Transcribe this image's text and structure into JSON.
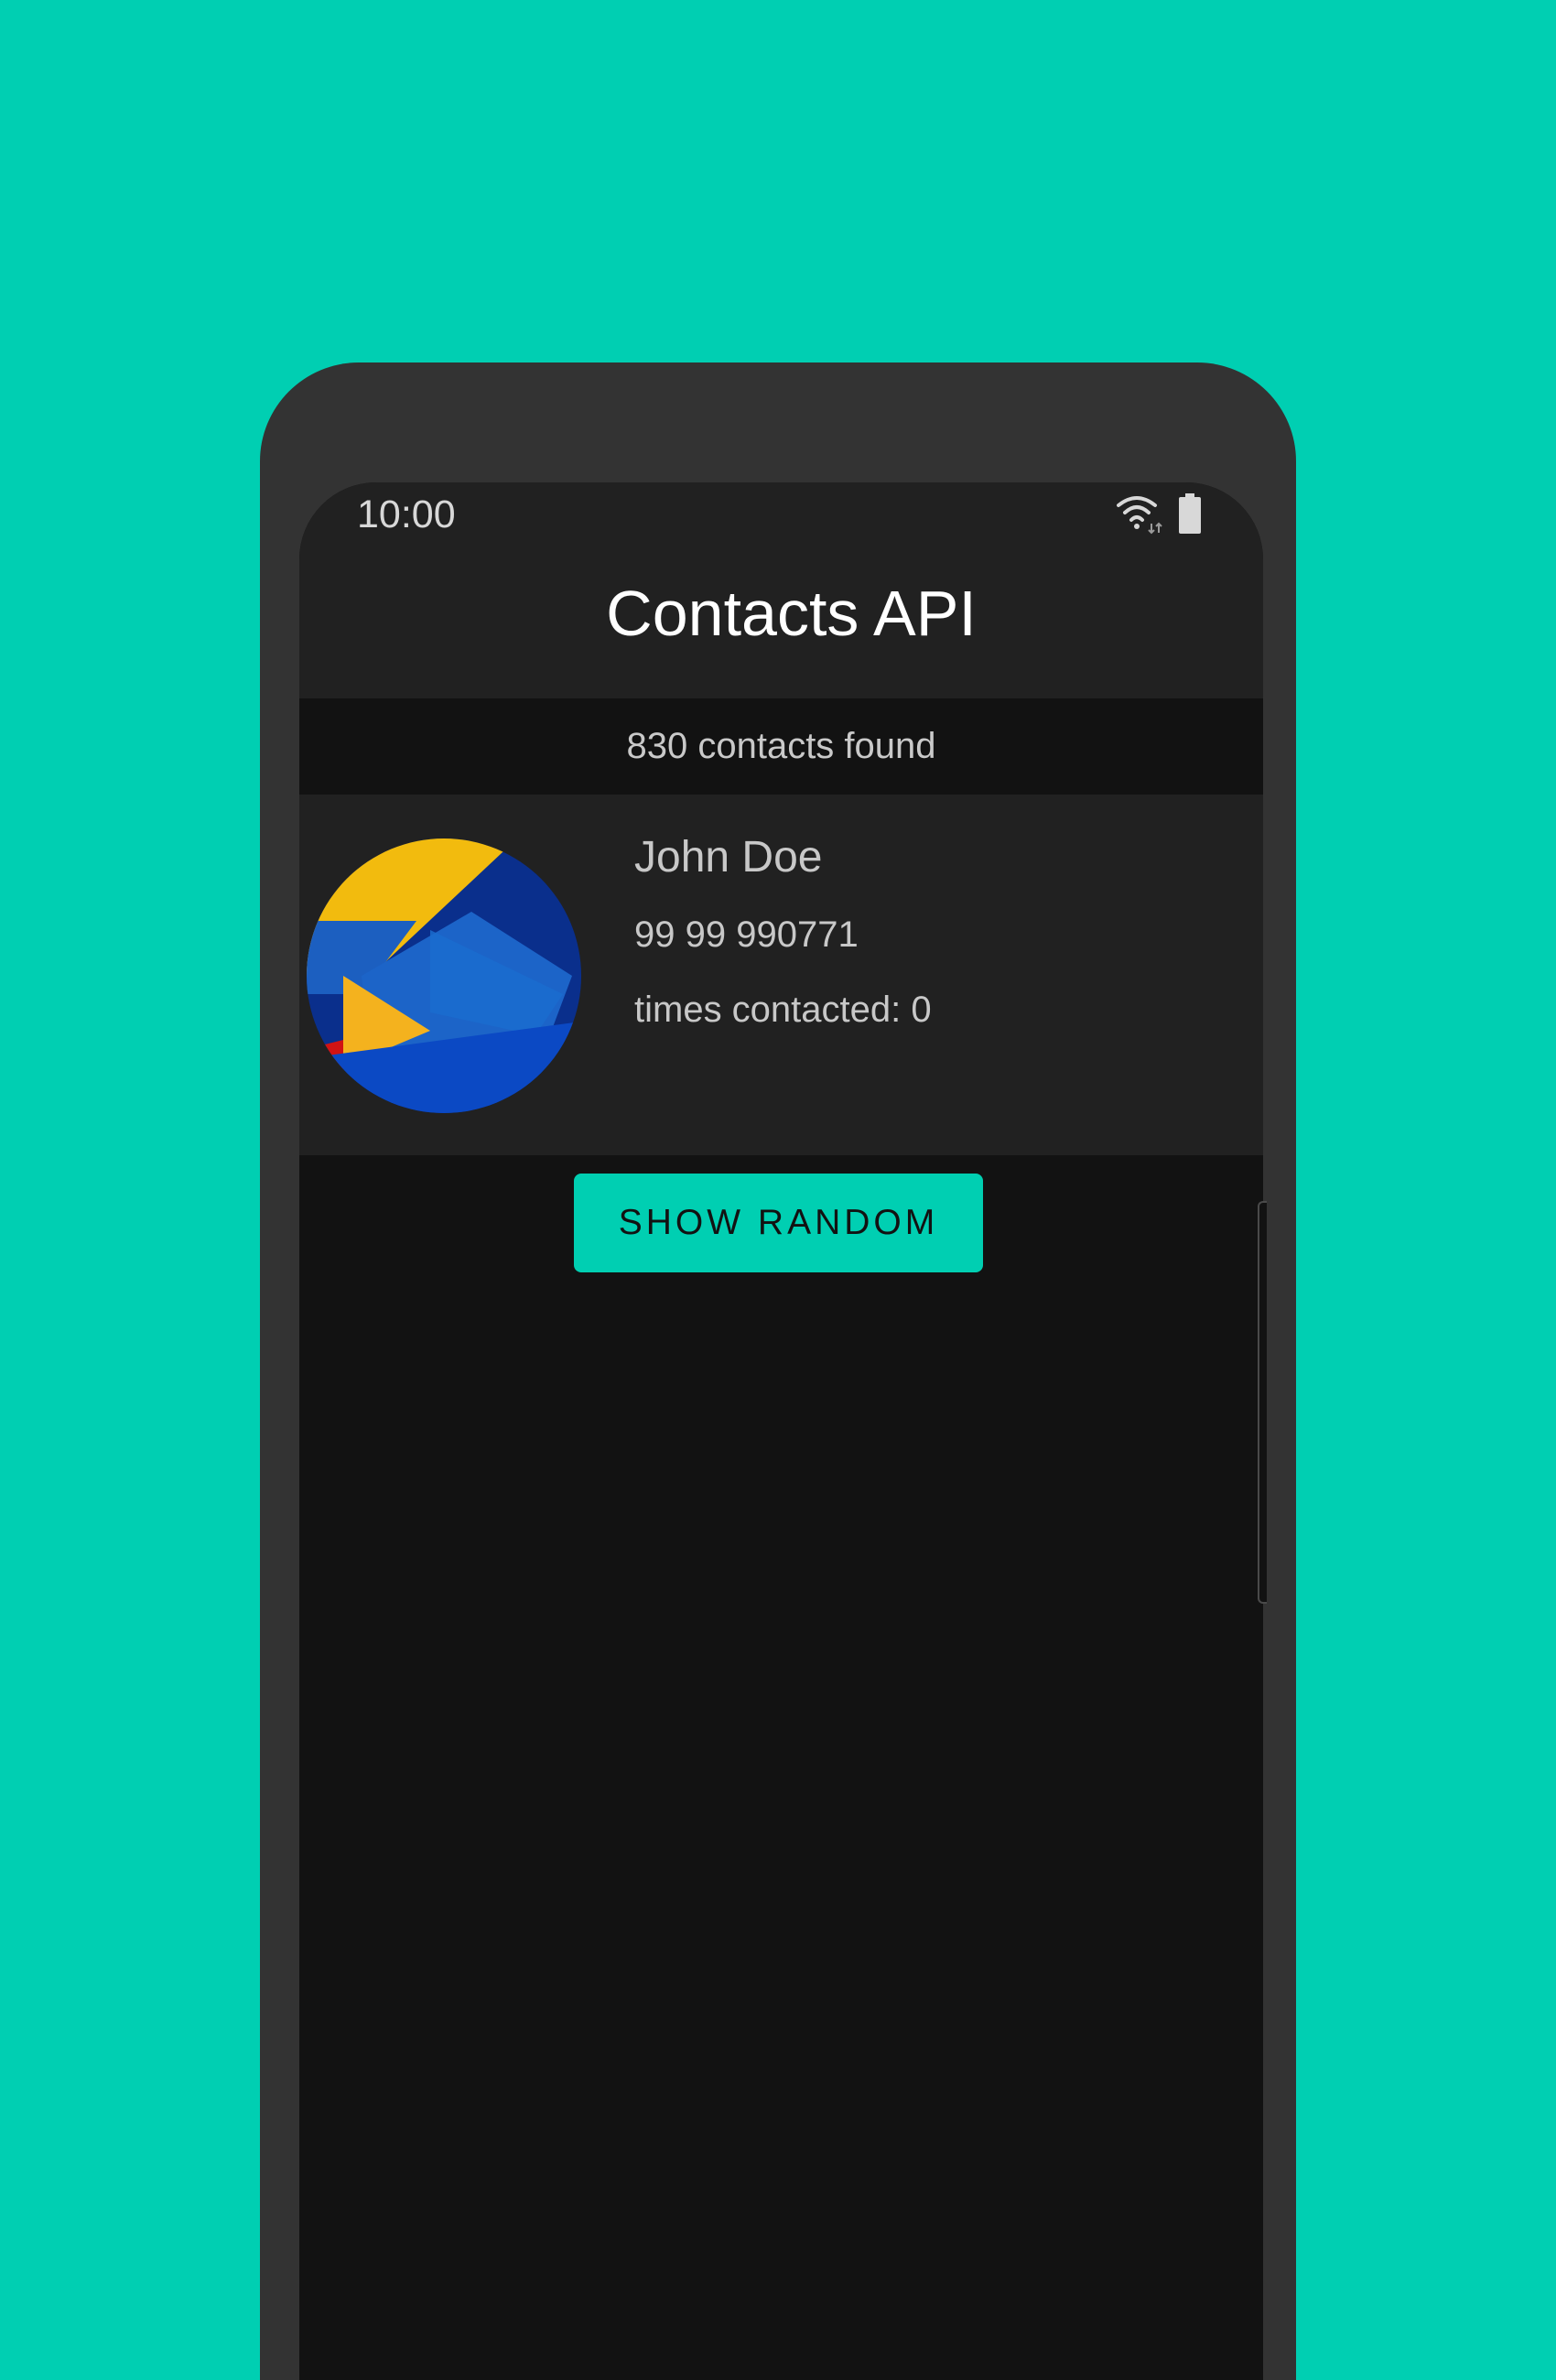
{
  "status_bar": {
    "time": "10:00",
    "icons": [
      "wifi-icon",
      "battery-icon"
    ]
  },
  "app_bar": {
    "title": "Contacts API"
  },
  "contacts_summary": {
    "text": "830 contacts found"
  },
  "contact": {
    "avatar_icon": "contact-photo",
    "name": "John Doe",
    "phone": "99 99 990771",
    "times_contacted": "times contacted: 0"
  },
  "actions": {
    "show_random_label": "SHOW RANDOM"
  },
  "colors": {
    "background_accent": "#00cfb2",
    "phone_frame": "#333333",
    "screen_background": "#121212",
    "surface": "#212121",
    "primary_text": "#ffffff",
    "secondary_text": "#c8c8c8"
  }
}
